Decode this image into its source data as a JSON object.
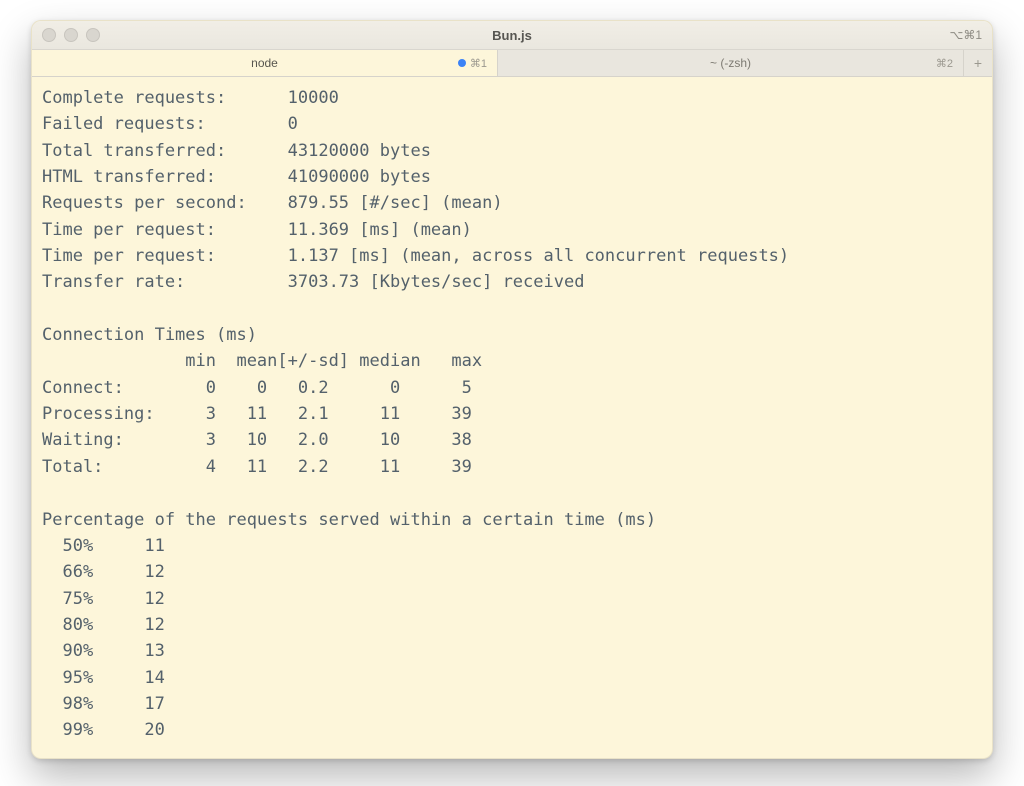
{
  "window": {
    "title": "Bun.js",
    "shortcut_hint": "⌥⌘1"
  },
  "tabs": [
    {
      "label": "node",
      "active": true,
      "indicator": "●",
      "shortcut": "⌘1"
    },
    {
      "label": "~ (-zsh)",
      "active": false,
      "indicator": "",
      "shortcut": "⌘2"
    }
  ],
  "newtab_glyph": "+",
  "output": {
    "summary": [
      {
        "label": "Complete requests:",
        "value": "10000"
      },
      {
        "label": "Failed requests:",
        "value": "0"
      },
      {
        "label": "Total transferred:",
        "value": "43120000 bytes"
      },
      {
        "label": "HTML transferred:",
        "value": "41090000 bytes"
      },
      {
        "label": "Requests per second:",
        "value": "879.55 [#/sec] (mean)"
      },
      {
        "label": "Time per request:",
        "value": "11.369 [ms] (mean)"
      },
      {
        "label": "Time per request:",
        "value": "1.137 [ms] (mean, across all concurrent requests)"
      },
      {
        "label": "Transfer rate:",
        "value": "3703.73 [Kbytes/sec] received"
      }
    ],
    "conn_title": "Connection Times (ms)",
    "conn_header": "              min  mean[+/-sd] median   max",
    "conn_rows": [
      {
        "label": "Connect:",
        "min": "0",
        "mean": "0",
        "sd": "0.2",
        "median": "0",
        "max": "5"
      },
      {
        "label": "Processing:",
        "min": "3",
        "mean": "11",
        "sd": "2.1",
        "median": "11",
        "max": "39"
      },
      {
        "label": "Waiting:",
        "min": "3",
        "mean": "10",
        "sd": "2.0",
        "median": "10",
        "max": "38"
      },
      {
        "label": "Total:",
        "min": "4",
        "mean": "11",
        "sd": "2.2",
        "median": "11",
        "max": "39"
      }
    ],
    "pct_title": "Percentage of the requests served within a certain time (ms)",
    "pct_rows": [
      {
        "pct": "50%",
        "ms": "11"
      },
      {
        "pct": "66%",
        "ms": "12"
      },
      {
        "pct": "75%",
        "ms": "12"
      },
      {
        "pct": "80%",
        "ms": "12"
      },
      {
        "pct": "90%",
        "ms": "13"
      },
      {
        "pct": "95%",
        "ms": "14"
      },
      {
        "pct": "98%",
        "ms": "17"
      },
      {
        "pct": "99%",
        "ms": "20"
      }
    ]
  }
}
